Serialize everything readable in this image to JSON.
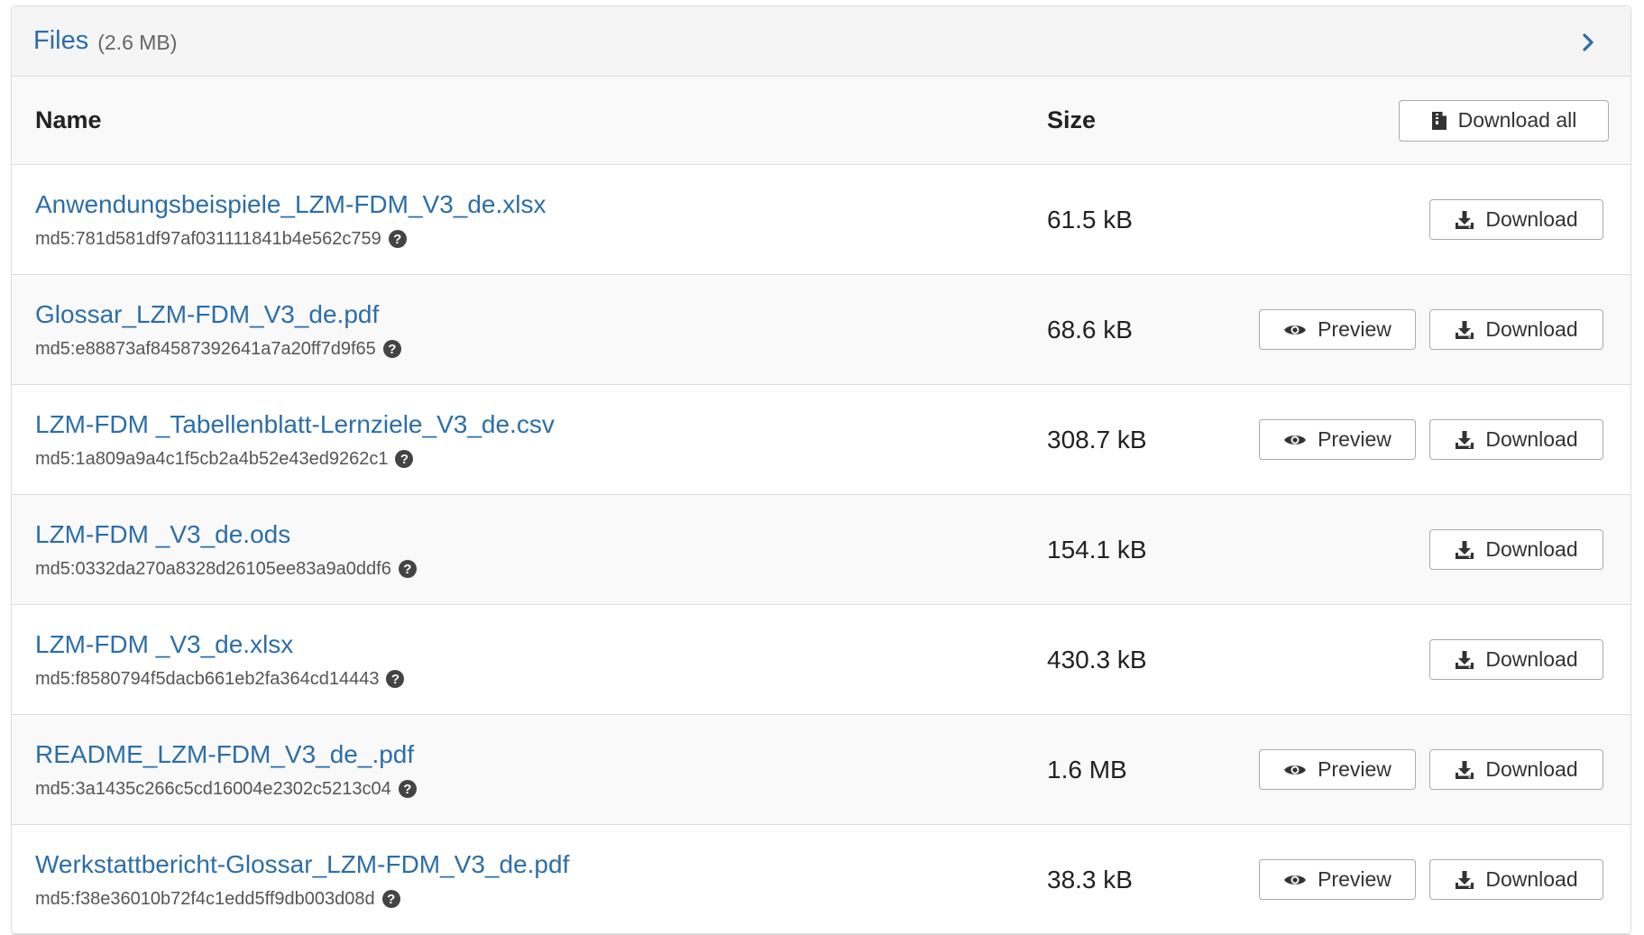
{
  "panel": {
    "title": "Files",
    "total_size": "(2.6 MB)",
    "toggle_icon": "chevron-right-icon"
  },
  "table": {
    "headers": {
      "name": "Name",
      "size": "Size"
    },
    "download_all_label": "Download all",
    "preview_label": "Preview",
    "download_label": "Download",
    "rows": [
      {
        "name": "Anwendungsbeispiele_LZM-FDM_V3_de.xlsx",
        "md5": "md5:781d581df97af031111841b4e562c759",
        "size": "61.5 kB",
        "preview": false
      },
      {
        "name": "Glossar_LZM-FDM_V3_de.pdf",
        "md5": "md5:e88873af84587392641a7a20ff7d9f65",
        "size": "68.6 kB",
        "preview": true
      },
      {
        "name": "LZM-FDM _Tabellenblatt-Lernziele_V3_de.csv",
        "md5": "md5:1a809a9a4c1f5cb2a4b52e43ed9262c1",
        "size": "308.7 kB",
        "preview": true
      },
      {
        "name": "LZM-FDM _V3_de.ods",
        "md5": "md5:0332da270a8328d26105ee83a9a0ddf6",
        "size": "154.1 kB",
        "preview": false
      },
      {
        "name": "LZM-FDM _V3_de.xlsx",
        "md5": "md5:f8580794f5dacb661eb2fa364cd14443",
        "size": "430.3 kB",
        "preview": false
      },
      {
        "name": "README_LZM-FDM_V3_de_.pdf",
        "md5": "md5:3a1435c266c5cd16004e2302c5213c04",
        "size": "1.6 MB",
        "preview": true
      },
      {
        "name": "Werkstattbericht-Glossar_LZM-FDM_V3_de.pdf",
        "md5": "md5:f38e36010b72f4c1edd5ff9db003d08d",
        "size": "38.3 kB",
        "preview": true
      }
    ]
  },
  "colors": {
    "link": "#2c6ea8",
    "header_bg": "#f5f5f5",
    "border": "#dcdcdc"
  }
}
